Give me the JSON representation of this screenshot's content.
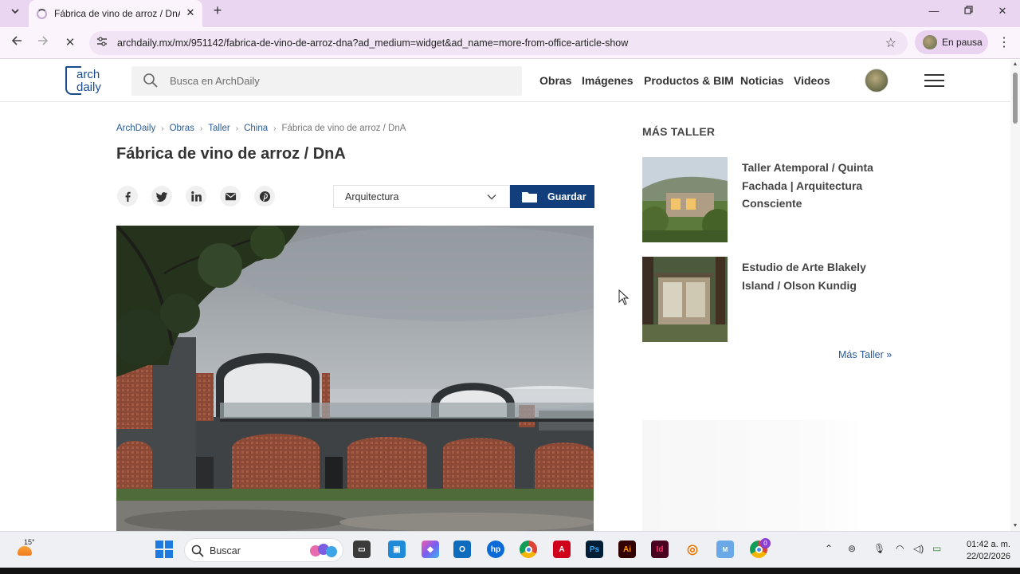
{
  "browser": {
    "tab": {
      "title": "Fábrica de vino de arroz / DnA |"
    },
    "address": {
      "url": "archdaily.mx/mx/951142/fabrica-de-vino-de-arroz-dna?ad_medium=widget&ad_name=more-from-office-article-show"
    },
    "profile": {
      "status": "En pausa"
    }
  },
  "header": {
    "logo": {
      "line1": "arch",
      "line2": "daily"
    },
    "search": {
      "placeholder": "Busca en ArchDaily"
    },
    "nav": [
      {
        "label": "Obras"
      },
      {
        "label": "Imágenes"
      },
      {
        "label": "Productos & BIM"
      },
      {
        "label": "Noticias"
      },
      {
        "label": "Videos"
      }
    ]
  },
  "article": {
    "breadcrumb": [
      "ArchDaily",
      "Obras",
      "Taller",
      "China",
      "Fábrica de vino de arroz / DnA"
    ],
    "title": "Fábrica de vino de arroz / DnA",
    "category": "Arquitectura",
    "save_label": "Guardar"
  },
  "sidebar": {
    "title": "MÁS TALLER",
    "items": [
      {
        "title": "Taller Atemporal / Quinta Fachada | Arquitectura Consciente"
      },
      {
        "title": "Estudio de Arte Blakely Island / Olson Kundig"
      }
    ],
    "more_label": "Más Taller »"
  },
  "taskbar": {
    "weather": {
      "temp": "15°"
    },
    "search_label": "Buscar",
    "time": "01:42 a. m.",
    "date": "22/02/2026",
    "chrome_badge": "0"
  }
}
